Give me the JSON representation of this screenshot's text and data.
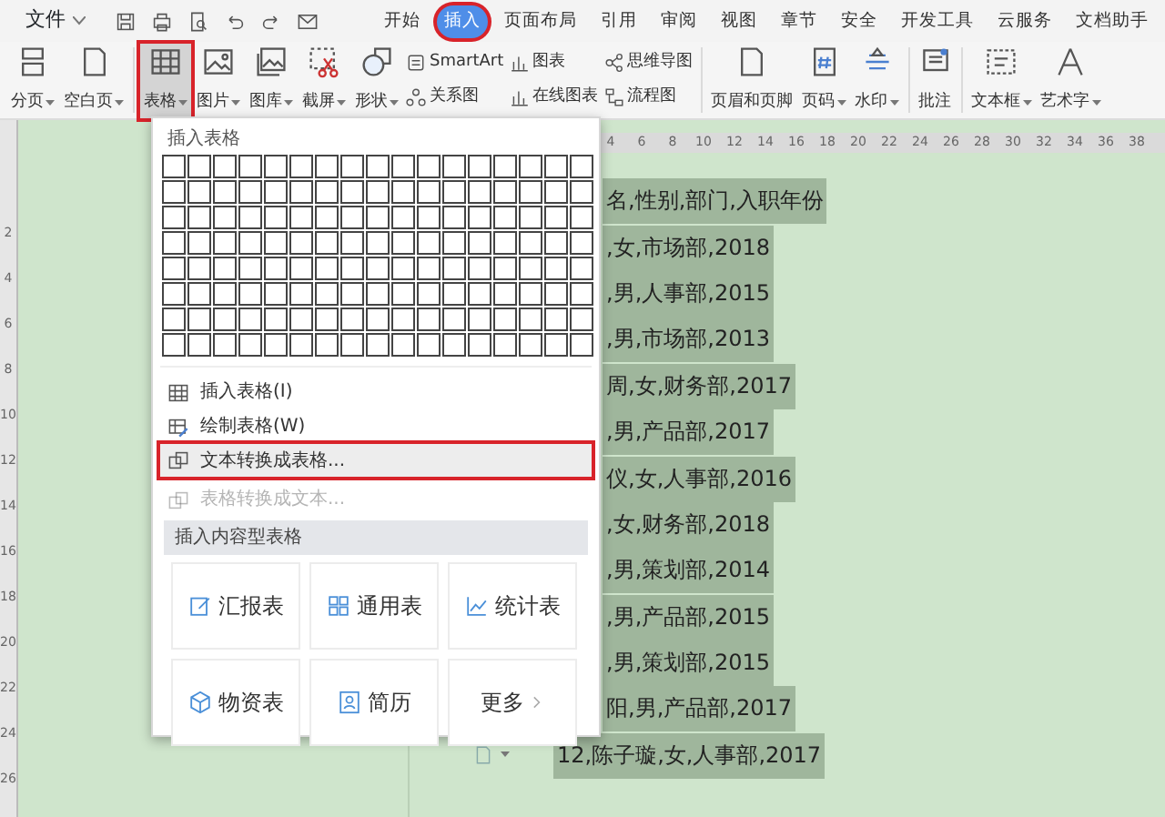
{
  "menu_bar": {
    "file_menu": "文件",
    "tabs": [
      {
        "label": "开始",
        "selected": false,
        "annotated": false
      },
      {
        "label": "插入",
        "selected": true,
        "annotated": true
      },
      {
        "label": "页面布局",
        "selected": false,
        "annotated": false
      },
      {
        "label": "引用",
        "selected": false,
        "annotated": false
      },
      {
        "label": "审阅",
        "selected": false,
        "annotated": false
      },
      {
        "label": "视图",
        "selected": false,
        "annotated": false
      },
      {
        "label": "章节",
        "selected": false,
        "annotated": false
      },
      {
        "label": "安全",
        "selected": false,
        "annotated": false
      },
      {
        "label": "开发工具",
        "selected": false,
        "annotated": false
      },
      {
        "label": "云服务",
        "selected": false,
        "annotated": false
      },
      {
        "label": "文档助手",
        "selected": false,
        "annotated": false
      }
    ]
  },
  "ribbon": {
    "items": [
      {
        "kind": "large",
        "label": "分页",
        "dropdown": true,
        "pressed": false,
        "annotated": false
      },
      {
        "kind": "large",
        "label": "空白页",
        "dropdown": true,
        "pressed": false,
        "annotated": false
      },
      {
        "kind": "separator"
      },
      {
        "kind": "large",
        "label": "表格",
        "dropdown": true,
        "pressed": true,
        "annotated": true
      },
      {
        "kind": "large",
        "label": "图片",
        "dropdown": true,
        "pressed": false,
        "annotated": false
      },
      {
        "kind": "large",
        "label": "图库",
        "dropdown": true,
        "pressed": false,
        "annotated": false
      },
      {
        "kind": "large",
        "label": "截屏",
        "dropdown": true,
        "pressed": false,
        "annotated": false
      },
      {
        "kind": "large",
        "label": "形状",
        "dropdown": true,
        "pressed": false,
        "annotated": false
      },
      {
        "kind": "stack",
        "items": [
          {
            "label": "SmartArt"
          },
          {
            "label": "关系图"
          }
        ]
      },
      {
        "kind": "stack",
        "items": [
          {
            "label": "图表"
          },
          {
            "label": "在线图表"
          }
        ]
      },
      {
        "kind": "stack",
        "items": [
          {
            "label": "思维导图"
          },
          {
            "label": "流程图"
          }
        ]
      },
      {
        "kind": "separator"
      },
      {
        "kind": "large",
        "label": "页眉和页脚",
        "dropdown": false,
        "pressed": false,
        "annotated": false
      },
      {
        "kind": "large",
        "label": "页码",
        "dropdown": true,
        "pressed": false,
        "annotated": false
      },
      {
        "kind": "large",
        "label": "水印",
        "dropdown": true,
        "pressed": false,
        "annotated": false
      },
      {
        "kind": "separator"
      },
      {
        "kind": "large",
        "label": "批注",
        "dropdown": false,
        "pressed": false,
        "annotated": false
      },
      {
        "kind": "separator"
      },
      {
        "kind": "large",
        "label": "文本框",
        "dropdown": true,
        "pressed": false,
        "annotated": false
      },
      {
        "kind": "large",
        "label": "艺术字",
        "dropdown": true,
        "pressed": false,
        "annotated": false
      }
    ]
  },
  "table_menu": {
    "title": "插入表格",
    "items": [
      {
        "label": "插入表格(I)",
        "disabled": false,
        "annotated": false
      },
      {
        "label": "绘制表格(W)",
        "disabled": false,
        "annotated": false
      },
      {
        "label": "文本转换成表格...",
        "disabled": false,
        "annotated": true
      },
      {
        "label": "表格转换成文本...",
        "disabled": true,
        "annotated": false
      }
    ],
    "section_title": "插入内容型表格",
    "tiles": [
      {
        "kind": "template",
        "label": "汇报表"
      },
      {
        "kind": "template",
        "label": "通用表"
      },
      {
        "kind": "template",
        "label": "统计表"
      },
      {
        "kind": "template",
        "label": "物资表"
      },
      {
        "kind": "template",
        "label": "简历"
      },
      {
        "kind": "more",
        "label": "更多"
      }
    ]
  },
  "document": {
    "ruler_h": [
      "4",
      "6",
      "8",
      "10",
      "12",
      "14",
      "16",
      "18",
      "20",
      "22",
      "24",
      "26",
      "28",
      "30",
      "32",
      "34",
      "36",
      "38"
    ],
    "ruler_v": [
      "2",
      "4",
      "6",
      "8",
      "10",
      "12",
      "14",
      "16",
      "18",
      "20",
      "22",
      "24",
      "26"
    ],
    "lines": [
      {
        "text": "名,性别,部门,入职年份",
        "kind": "clipped",
        "highlighted": true
      },
      {
        "text": ",女,市场部,2018",
        "kind": "clipped",
        "highlighted": true
      },
      {
        "text": ",男,人事部,2015",
        "kind": "clipped",
        "highlighted": true
      },
      {
        "text": ",男,市场部,2013",
        "kind": "clipped",
        "highlighted": true
      },
      {
        "text": "周,女,财务部,2017",
        "kind": "clipped",
        "highlighted": true
      },
      {
        "text": ",男,产品部,2017",
        "kind": "clipped",
        "highlighted": true
      },
      {
        "text": "仪,女,人事部,2016",
        "kind": "clipped",
        "highlighted": true
      },
      {
        "text": ",女,财务部,2018",
        "kind": "clipped",
        "highlighted": true
      },
      {
        "text": ",男,策划部,2014",
        "kind": "clipped",
        "highlighted": true
      },
      {
        "text": ",男,产品部,2015",
        "kind": "clipped",
        "highlighted": true
      },
      {
        "text": ",男,策划部,2015",
        "kind": "clipped",
        "highlighted": true
      },
      {
        "text": "阳,男,产品部,2017",
        "kind": "clipped",
        "highlighted": true
      },
      {
        "text": "12,陈子璇,女,人事部,2017",
        "kind": "full",
        "highlighted": true
      }
    ]
  }
}
